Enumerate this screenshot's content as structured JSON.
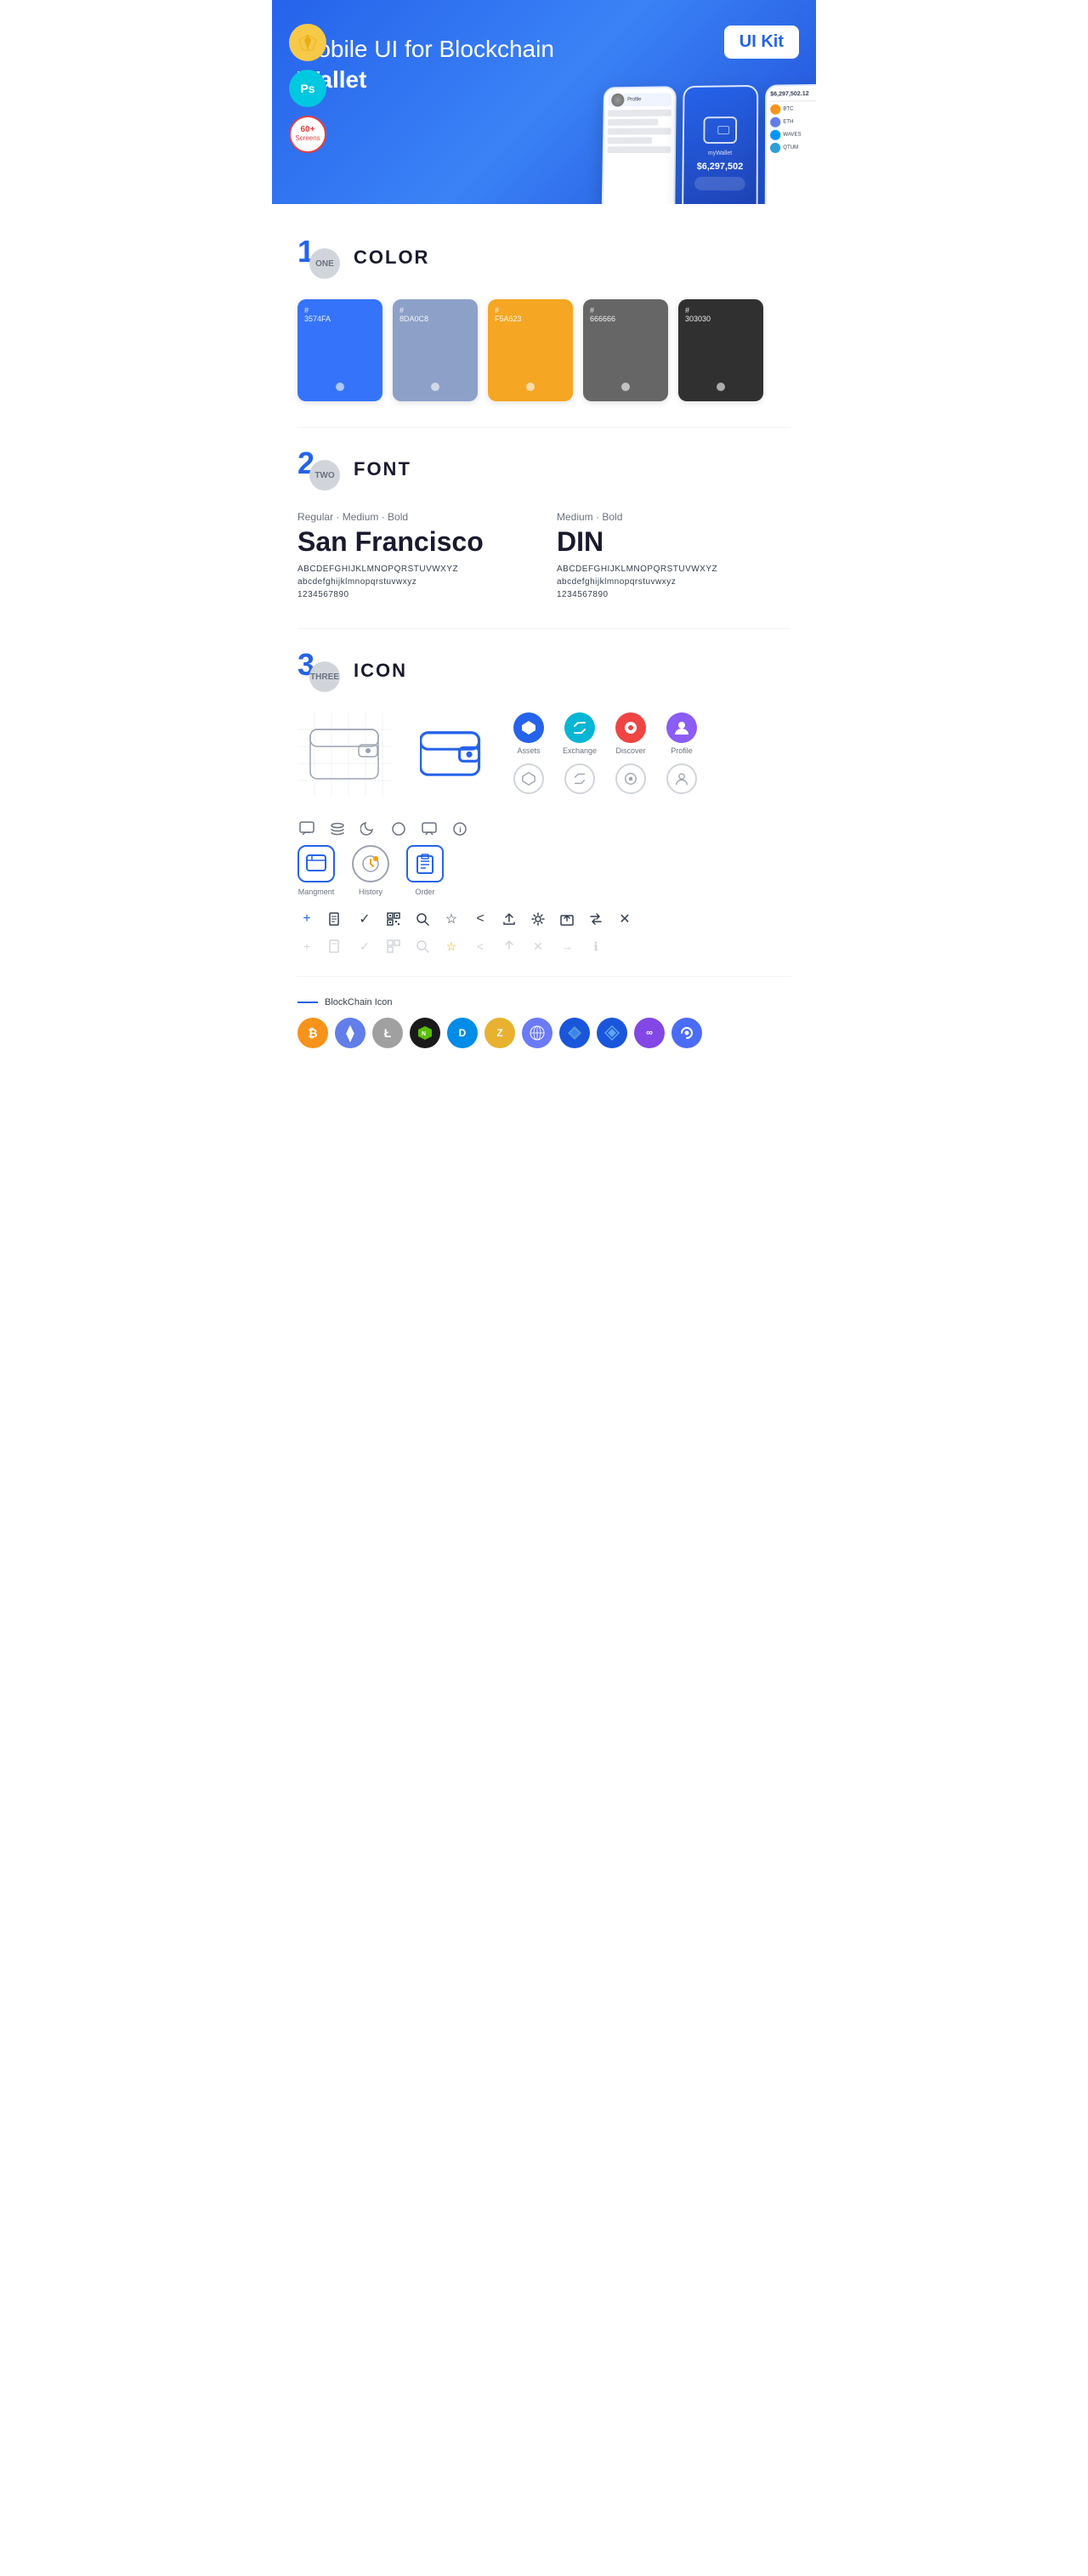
{
  "hero": {
    "title_normal": "Mobile UI for Blockchain ",
    "title_bold": "Wallet",
    "badge": "UI Kit",
    "badges": [
      {
        "id": "sketch",
        "label": "S"
      },
      {
        "id": "ps",
        "label": "Ps"
      },
      {
        "id": "screens",
        "line1": "60+",
        "line2": "Screens"
      }
    ]
  },
  "sections": [
    {
      "id": "color",
      "number": "1",
      "sub": "ONE",
      "title": "COLOR"
    },
    {
      "id": "font",
      "number": "2",
      "sub": "TWO",
      "title": "FONT"
    },
    {
      "id": "icon",
      "number": "3",
      "sub": "THREE",
      "title": "ICON"
    }
  ],
  "colors": [
    {
      "hex": "#3574FA",
      "label": "#\n3574FA",
      "bg": "#3574FA"
    },
    {
      "hex": "#8DA0C8",
      "label": "#\n8DA0C8",
      "bg": "#8DA0C8"
    },
    {
      "hex": "#F5A623",
      "label": "#\nF5A623",
      "bg": "#F5A623"
    },
    {
      "hex": "#666666",
      "label": "#\n666666",
      "bg": "#666666"
    },
    {
      "hex": "#303030",
      "label": "#\n303030",
      "bg": "#303030"
    }
  ],
  "fonts": [
    {
      "meta": "Regular · Medium · Bold",
      "name": "San Francisco",
      "uppercase": "ABCDEFGHIJKLMNOPQRSTUVWXYZ",
      "lowercase": "abcdefghijklmnopqrstuvwxyz",
      "numbers": "1234567890"
    },
    {
      "meta": "Medium · Bold",
      "name": "DIN",
      "uppercase": "ABCDEFGHIJKLMNOPQRSTUVWXYZ",
      "lowercase": "abcdefghijklmnopqrstuvwxyz",
      "numbers": "1234567890"
    }
  ],
  "icons": {
    "nav_items": [
      {
        "label": "Assets",
        "color": "ic-blue"
      },
      {
        "label": "Exchange",
        "color": "ic-cyan"
      },
      {
        "label": "Discover",
        "color": "ic-red"
      },
      {
        "label": "Profile",
        "color": "ic-purple"
      }
    ],
    "nav_items_ghost": [
      {
        "label": "Assets"
      },
      {
        "label": "Exchange"
      },
      {
        "label": "Discover"
      },
      {
        "label": "Profile"
      }
    ],
    "mgmt_items": [
      {
        "label": "Mangment"
      },
      {
        "label": "History"
      },
      {
        "label": "Order"
      }
    ],
    "utility_row1": [
      "+",
      "⊞",
      "✓",
      "⊡",
      "⌕",
      "☆",
      "<",
      "≪",
      "⚙",
      "⊡",
      "⇄",
      "✕"
    ],
    "utility_row2": [
      "+",
      "⊞",
      "✓",
      "⊡",
      "⌕",
      "☆",
      "<",
      "≪",
      "✕",
      "→",
      "ℹ"
    ],
    "blockchain_label": "BlockChain Icon",
    "crypto": [
      {
        "symbol": "₿",
        "class": "ci-btc",
        "name": "Bitcoin"
      },
      {
        "symbol": "Ξ",
        "class": "ci-eth",
        "name": "Ethereum"
      },
      {
        "symbol": "Ł",
        "class": "ci-ltc",
        "name": "Litecoin"
      },
      {
        "symbol": "N",
        "class": "ci-neo",
        "name": "NEO"
      },
      {
        "symbol": "D",
        "class": "ci-dash",
        "name": "Dash"
      },
      {
        "symbol": "Z",
        "class": "ci-zcash",
        "name": "Zcash"
      },
      {
        "symbol": "◈",
        "class": "ci-grid",
        "name": "Grid"
      },
      {
        "symbol": "▲",
        "class": "ci-waves",
        "name": "Waves"
      },
      {
        "symbol": "◆",
        "class": "ci-stratis",
        "name": "Stratis"
      },
      {
        "symbol": "∞",
        "class": "ci-matic",
        "name": "Matic"
      },
      {
        "symbol": "●",
        "class": "ci-band",
        "name": "Band"
      }
    ]
  }
}
